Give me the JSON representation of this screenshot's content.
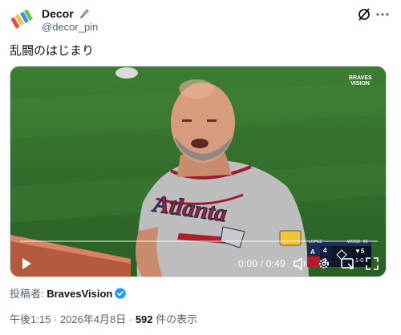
{
  "author": {
    "name": "Decor",
    "handle": "@decor_pin"
  },
  "icons": {
    "avatar": "paint-tubes-avatar-icon",
    "name_badge": "paintbrush-icon",
    "grok": "grok-icon",
    "more": "more-icon"
  },
  "tweet": {
    "text": "乱闘のはじまり"
  },
  "video": {
    "brand_badge": "BRAVES VISION",
    "jersey_text": "Atlanta",
    "progress": 0,
    "time": "0:00 / 0:49",
    "scoreboard": {
      "pitcher": "LOPEZ",
      "batter": "WOOD",
      "pitch_count": "80",
      "away_score": "4",
      "home_score": "1",
      "inning": "▼5",
      "count": "1-0"
    }
  },
  "source": {
    "label": "投稿者: ",
    "account": "BravesVision"
  },
  "meta": {
    "time": "午後1:15",
    "separator": " · ",
    "date": "2026年4月8日",
    "views": "592",
    "views_label": " 件の表示"
  },
  "colors": {
    "accent": "#1d9bf0",
    "text": "#0f1419",
    "muted": "#536471"
  }
}
